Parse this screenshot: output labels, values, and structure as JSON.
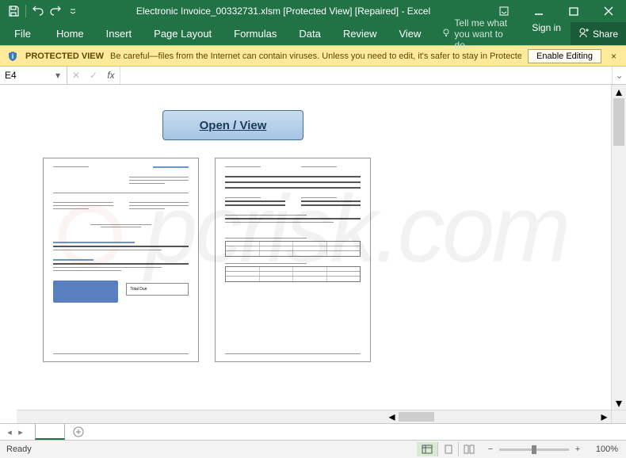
{
  "titlebar": {
    "title": "Electronic Invoice_00332731.xlsm  [Protected View] [Repaired] - Excel"
  },
  "ribbon": {
    "file": "File",
    "tabs": [
      "Home",
      "Insert",
      "Page Layout",
      "Formulas",
      "Data",
      "Review",
      "View"
    ],
    "tell": "Tell me what you want to do...",
    "signin": "Sign in",
    "share": "Share"
  },
  "protected_view": {
    "title": "PROTECTED VIEW",
    "message": "Be careful—files from the Internet can contain viruses. Unless you need to edit, it's safer to stay in Protected View.",
    "enable": "Enable Editing"
  },
  "formula_bar": {
    "name_box": "E4",
    "fx_label": "fx",
    "value": ""
  },
  "sheet": {
    "open_view_label": "Open / View",
    "tab_name": " ",
    "doc1_total_label": "Total Due"
  },
  "status": {
    "ready": "Ready",
    "zoom": "100%"
  }
}
